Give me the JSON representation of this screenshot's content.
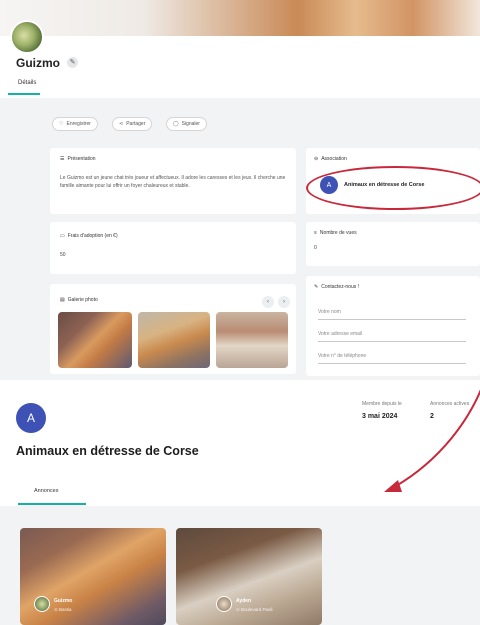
{
  "pet": {
    "name": "Guizmo",
    "tab": "Détails"
  },
  "actions": {
    "save": "Enregistrer",
    "share": "Partager",
    "report": "Signaler"
  },
  "presentation": {
    "title": "Présentation",
    "text": "Le Guizmo est un jeune chat très joueur et affectueux. Il adore les caresses et les jeux. Il cherche une famille aimante pour lui offrir un foyer chaleureux et stable."
  },
  "association_card": {
    "title": "Association",
    "avatar_letter": "A",
    "name": "Animaux en détresse de Corse"
  },
  "fees": {
    "title": "Frais d'adoption (en €)",
    "value": "50"
  },
  "views": {
    "title": "Nombre de vues",
    "value": "0"
  },
  "gallery": {
    "title": "Galerie photo",
    "prev": "‹",
    "next": "›"
  },
  "contact": {
    "title": "Contactez-nous !",
    "name_placeholder": "Votre nom",
    "email_placeholder": "Votre adresse email",
    "phone_placeholder": "Votre n° de téléphone"
  },
  "association_page": {
    "avatar_letter": "A",
    "member_since_label": "Membre depuis le",
    "member_since_value": "3 mai 2024",
    "ads_label": "Annonces actives",
    "ads_value": "2",
    "title": "Animaux en détresse de Corse",
    "tab": "Annonces"
  },
  "listings": [
    {
      "name": "Guizmo",
      "place": "Bastia"
    },
    {
      "name": "Ayden",
      "place": "Boulevard Paoli"
    }
  ],
  "colors": {
    "accent_teal": "#12b3a6",
    "association_blue": "#3e51b5",
    "highlight_red": "#c7283a"
  }
}
